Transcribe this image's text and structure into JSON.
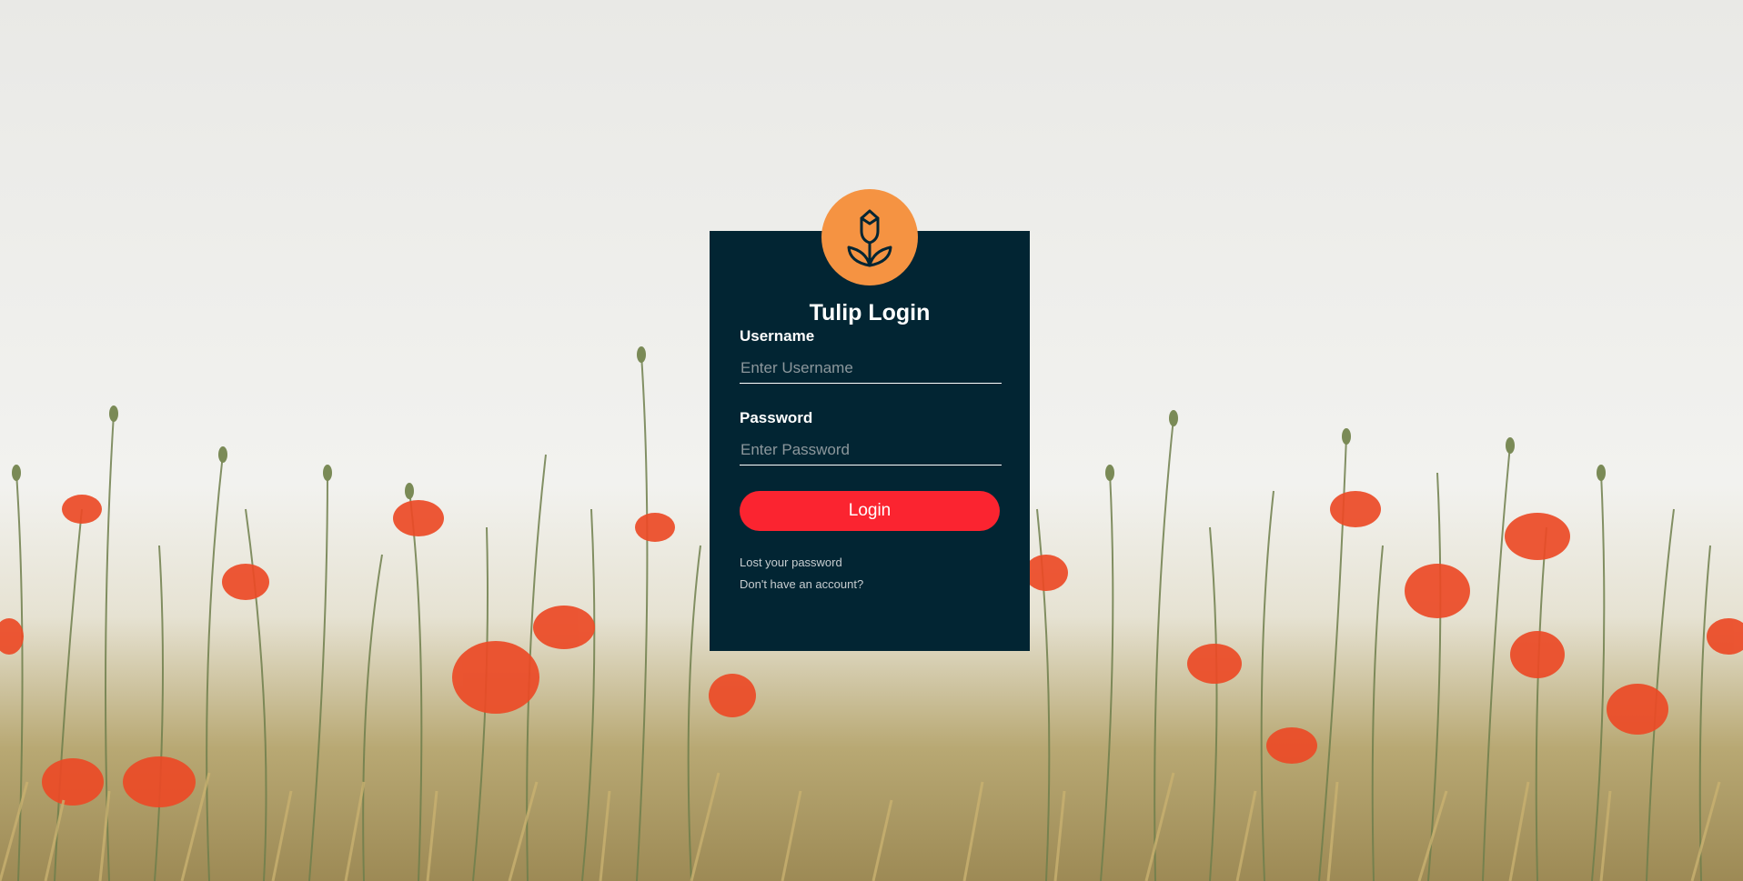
{
  "app": {
    "title": "Tulip Login",
    "logo_icon": "tulip-icon",
    "accent_color": "#f59342",
    "panel_color": "#022533",
    "button_color": "#fb2430"
  },
  "form": {
    "username": {
      "label": "Username",
      "value": "",
      "placeholder": "Enter Username"
    },
    "password": {
      "label": "Password",
      "value": "",
      "placeholder": "Enter Password"
    },
    "submit_label": "Login"
  },
  "links": {
    "lost_password": "Lost your password",
    "register": "Don't have an account?"
  }
}
